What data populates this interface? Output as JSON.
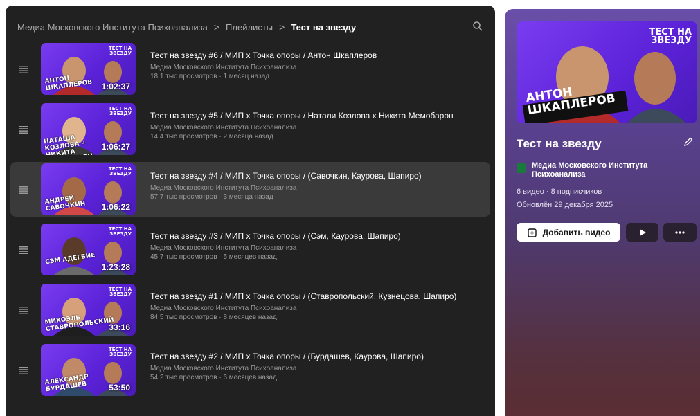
{
  "breadcrumb": {
    "channel": "Медиа Московского Института Психоанализа",
    "section": "Плейлисты",
    "current": "Тест на звезду",
    "separator": ">"
  },
  "icons": {
    "search": "search-icon",
    "drag": "drag-handle-icon",
    "edit": "pencil-icon",
    "add_video": "add-video-icon",
    "play": "play-icon",
    "more": "more-icon"
  },
  "videos": [
    {
      "title": "Тест на звезду #6 / МИП х Точка опоры / Антон Шкаплеров",
      "channel": "Медиа Московского Института Психоанализа",
      "meta": "18,1 тыс просмотров · 1 месяц назад",
      "duration": "1:02:37",
      "thumb_caption": "АНТОН ШКАПЛЕРОВ",
      "progress": 0.0
    },
    {
      "title": "Тест на звезду #5 / МИП х Точка опоры / Натали Козлова х Никита Мемобарон",
      "channel": "Медиа Московского Института Психоанализа",
      "meta": "14,4 тыс просмотров · 2 месяца назад",
      "duration": "1:06:27",
      "thumb_caption": "НАТАША КОЗЛОВА + НИКИТА МЕМОБАРОН",
      "progress": 0.0
    },
    {
      "title": "Тест на звезду #4 / МИП х Точка опоры / (Савочкин, Каурова, Шапиро)",
      "channel": "Медиа Московского Института Психоанализа",
      "meta": "57,7 тыс просмотров · 3 месяца назад",
      "duration": "1:06:22",
      "thumb_caption": "АНДРЕЙ САВОЧКИН",
      "progress": 0.0,
      "active": true
    },
    {
      "title": "Тест на звезду #3 / МИП х Точка опоры / (Сэм, Каурова, Шапиро)",
      "channel": "Медиа Московского Института Психоанализа",
      "meta": "45,7 тыс просмотров · 5 месяцев назад",
      "duration": "1:23:28",
      "thumb_caption": "СЭМ АДЕГБИЕ",
      "progress": 0.0
    },
    {
      "title": "Тест на звезду #1 / МИП х Точка опоры / (Ставропольский, Кузнецова, Шапиро)",
      "channel": "Медиа Московского Института Психоанализа",
      "meta": "84,5 тыс просмотров · 8 месяцев назад",
      "duration": "33:16",
      "thumb_caption": "МИХОЭЛЬ СТАВРОПОЛЬСКИЙ",
      "progress": 0.0
    },
    {
      "title": "Тест на звезду #2 / МИП х Точка опоры / (Бурдашев, Каурова, Шапиро)",
      "channel": "Медиа Московского Института Психоанализа",
      "meta": "54,2 тыс просмотров · 6 месяцев назад",
      "duration": "53:50",
      "thumb_caption": "АЛЕКСАНДР БУРДАШЕВ",
      "progress": 0.0
    }
  ],
  "thumb_badge": "ТЕСТ НА ЗВЕЗДУ",
  "playlist": {
    "title": "Тест на звезду",
    "cover_caption": "АНТОН ШКАПЛЕРОВ",
    "cover_badge": "ТЕСТ НА ЗВЕЗДУ",
    "channel": "Медиа Московского Института Психоанализа",
    "stats": "6 видео · 8 подписчиков",
    "updated": "Обновлён 29 декабря 2025",
    "add_video_label": "Добавить видео"
  }
}
